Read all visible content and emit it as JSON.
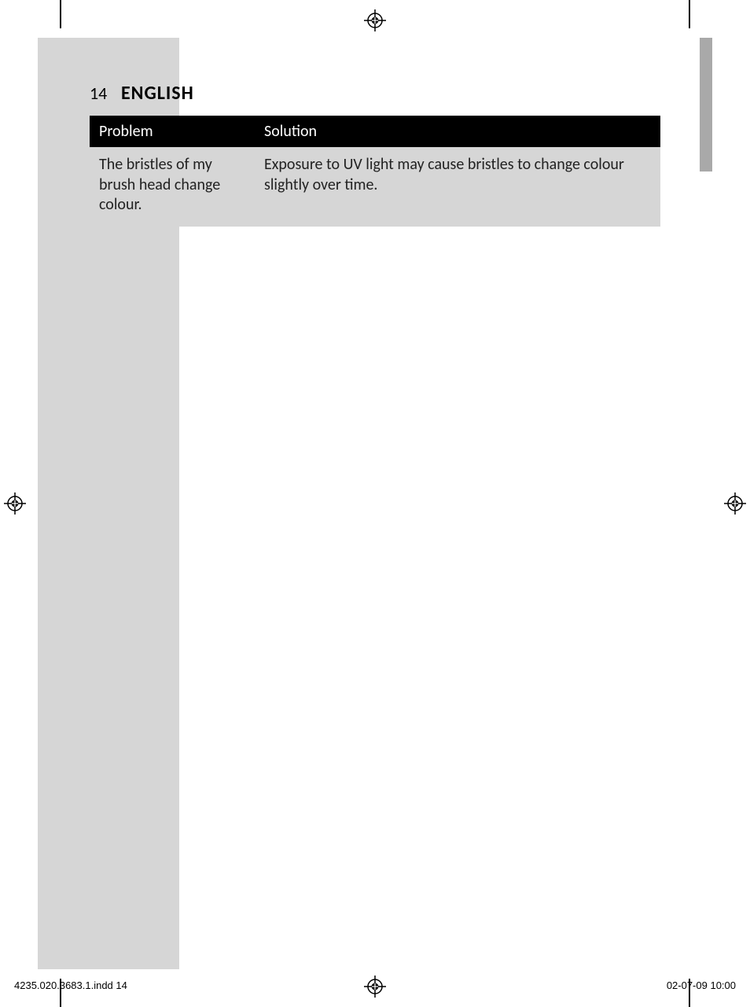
{
  "header": {
    "page_number": "14",
    "language": "ENGLISH"
  },
  "table": {
    "columns": {
      "problem": "Problem",
      "solution": "Solution"
    },
    "rows": [
      {
        "problem": "The bristles of my brush head change colour.",
        "solution": "Exposure to UV light may cause bristles to change colour slightly over time."
      }
    ]
  },
  "footer": {
    "left": "4235.020.3683.1.indd   14",
    "right": "02-07-09   10:00"
  }
}
